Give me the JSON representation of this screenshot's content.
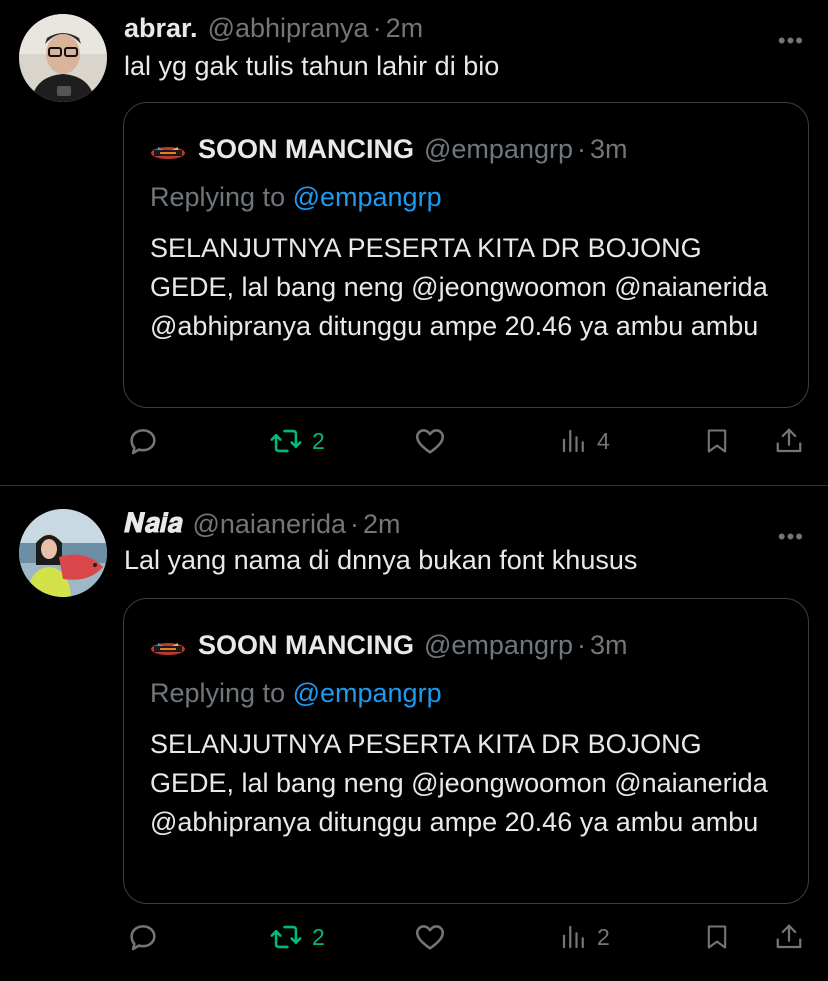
{
  "colors": {
    "background": "#000000",
    "text": "#e7e9ea",
    "secondary": "#71767b",
    "mention": "#1d9bf0",
    "retweet": "#00ba7c",
    "border": "#2f3336"
  },
  "tweets": [
    {
      "name": "abrar.",
      "handle": "@abhipranya",
      "dot": "·",
      "time": "2m",
      "more": "•••",
      "text": "lal yg gak tulis tahun lahir di bio",
      "quote": {
        "name": "SOON MANCING",
        "handle": "@empangrp",
        "dot": "·",
        "time": "3m",
        "reply_prefix": "Replying to ",
        "reply_mention": "@empangrp",
        "text": "SELANJUTNYA PESERTA KITA DR BOJONG GEDE, lal bang neng @jeongwoomon @naianerida @abhipranya ditunggu ampe 20.46 ya ambu ambu"
      },
      "actions": {
        "reply_icon": "reply-icon",
        "retweet_icon": "retweet-icon",
        "retweet_count": "2",
        "like_icon": "heart-icon",
        "views_icon": "views-icon",
        "views_count": "4",
        "bookmark_icon": "bookmark-icon",
        "share_icon": "share-icon"
      }
    },
    {
      "name": "𝑵𝒂𝒊𝒂",
      "handle": "@naianerida",
      "dot": "·",
      "time": "2m",
      "more": "•••",
      "text": "Lal yang nama di dnnya bukan font khusus",
      "quote": {
        "name": "SOON MANCING",
        "handle": "@empangrp",
        "dot": "·",
        "time": "3m",
        "reply_prefix": "Replying to ",
        "reply_mention": "@empangrp",
        "text": "SELANJUTNYA PESERTA KITA DR BOJONG GEDE, lal bang neng @jeongwoomon @naianerida @abhipranya ditunggu ampe 20.46 ya ambu ambu"
      },
      "actions": {
        "reply_icon": "reply-icon",
        "retweet_icon": "retweet-icon",
        "retweet_count": "2",
        "like_icon": "heart-icon",
        "views_icon": "views-icon",
        "views_count": "2",
        "bookmark_icon": "bookmark-icon",
        "share_icon": "share-icon"
      }
    }
  ]
}
